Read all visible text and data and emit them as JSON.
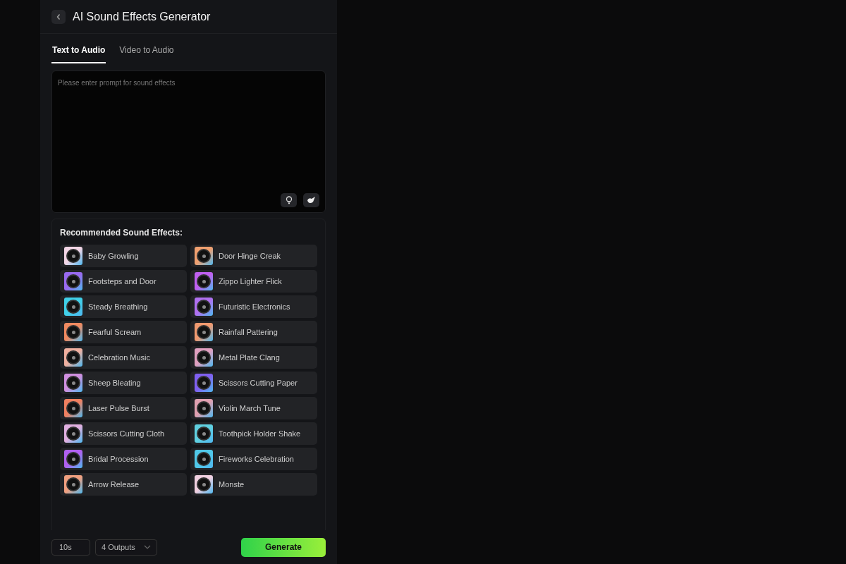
{
  "header": {
    "title": "AI Sound Effects Generator"
  },
  "tabs": [
    {
      "label": "Text to Audio",
      "selected": true
    },
    {
      "label": "Video to Audio",
      "selected": false
    }
  ],
  "prompt": {
    "placeholder": "Please enter prompt for sound effects"
  },
  "recommended": {
    "title": "Recommended Sound Effects:",
    "items": [
      {
        "label": "Baby Growling",
        "color": "#f3d6e6"
      },
      {
        "label": "Door Hinge Creak",
        "color": "#f0a070"
      },
      {
        "label": "Footsteps and Door",
        "color": "#9a6af0"
      },
      {
        "label": "Zippo Lighter Flick",
        "color": "#c060f0"
      },
      {
        "label": "Steady Breathing",
        "color": "#40d0e8"
      },
      {
        "label": "Futuristic Electronics",
        "color": "#b070f0"
      },
      {
        "label": "Fearful Scream",
        "color": "#f08a60"
      },
      {
        "label": "Rainfall Pattering",
        "color": "#f09a70"
      },
      {
        "label": "Celebration Music",
        "color": "#f0b0a0"
      },
      {
        "label": "Metal Plate Clang",
        "color": "#e0a0c0"
      },
      {
        "label": "Sheep Bleating",
        "color": "#d090e0"
      },
      {
        "label": "Scissors Cutting Paper",
        "color": "#8060f0"
      },
      {
        "label": "Laser Pulse Burst",
        "color": "#f08060"
      },
      {
        "label": "Violin March Tune",
        "color": "#e0a0b0"
      },
      {
        "label": "Scissors Cutting Cloth",
        "color": "#e0b0e0"
      },
      {
        "label": "Toothpick Holder Shake",
        "color": "#60d0e0"
      },
      {
        "label": "Bridal Procession",
        "color": "#b060f0"
      },
      {
        "label": "Fireworks Celebration",
        "color": "#50c8e8"
      },
      {
        "label": "Arrow Release",
        "color": "#f0a080"
      },
      {
        "label": "Monste",
        "color": "#f0d0e0"
      }
    ]
  },
  "controls": {
    "duration": "10s",
    "outputs": "4 Outputs",
    "generate": "Generate"
  }
}
